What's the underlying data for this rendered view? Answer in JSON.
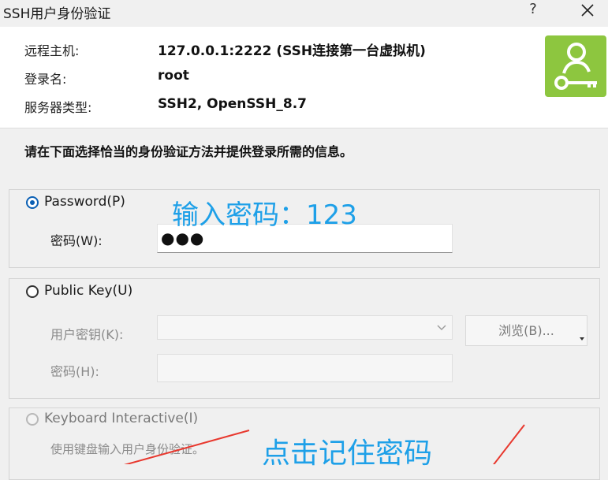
{
  "window": {
    "title": "SSH用户身份验证",
    "help_label": "?"
  },
  "info": {
    "host_label": "远程主机:",
    "host_value": "127.0.0.1:2222 (SSH连接第一台虚拟机)",
    "user_label": "登录名:",
    "user_value": "root",
    "server_label": "服务器类型:",
    "server_value": "SSH2, OpenSSH_8.7",
    "badge_color": "#8dc63f"
  },
  "instruction": "请在下面选择恰当的身份验证方法并提供登录所需的信息。",
  "password_group": {
    "radio_label": "Password(P)",
    "selected": true,
    "field_label": "密码(W):",
    "field_value": "●●●"
  },
  "publickey_group": {
    "radio_label": "Public Key(U)",
    "selected": false,
    "key_label": "用户密钥(K):",
    "key_value": "",
    "browse_label": "浏览(B)...",
    "pass_label": "密码(H):",
    "pass_value": ""
  },
  "keyboard_group": {
    "radio_label": "Keyboard Interactive(I)",
    "selected": false,
    "description": "使用键盘输入用户身份验证。"
  },
  "annotations": {
    "enter_password": "输入密码：123",
    "click_remember": "点击记住密码",
    "text_color": "#1ea0e8",
    "arrow_color": "#e8382e"
  }
}
